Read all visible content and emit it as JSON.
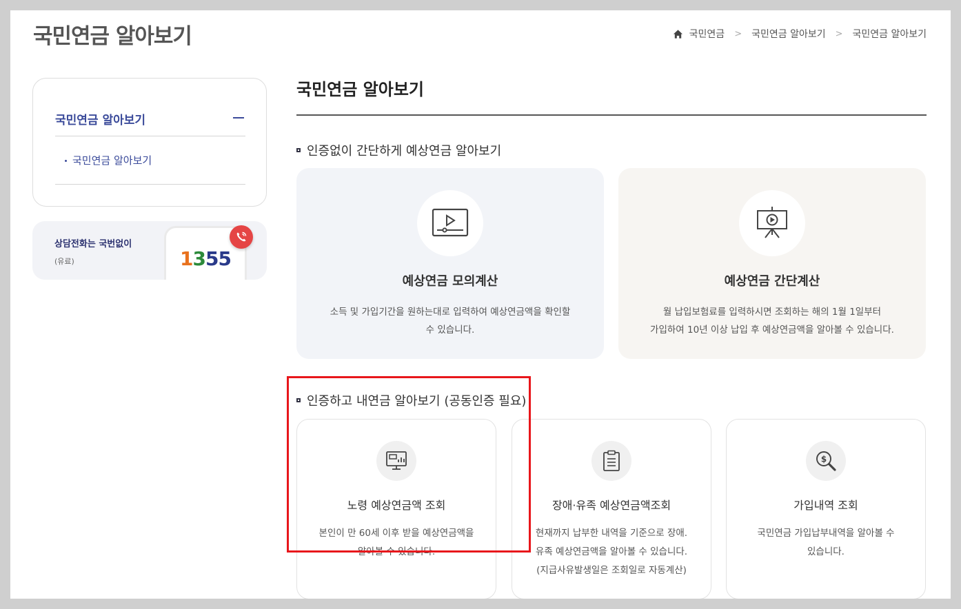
{
  "header": {
    "page_title": "국민연금 알아보기",
    "breadcrumb": [
      "국민연금",
      "국민연금 알아보기",
      "국민연금 알아보기"
    ]
  },
  "sidebar": {
    "menu_title": "국민연금 알아보기",
    "sub_item": "국민연금 알아보기"
  },
  "call_banner": {
    "title": "상담전화는 국번없이",
    "subtitle": "(유료)",
    "number_digits": [
      "1",
      "3",
      "5",
      "5"
    ],
    "digit_colors": [
      "#e8711d",
      "#2c8a3a",
      "#2a3a8a",
      "#2a3a8a"
    ],
    "badge_color": "#e54545"
  },
  "main": {
    "title": "국민연금 알아보기",
    "section1": {
      "title": "인증없이 간단하게 예상연금 알아보기",
      "cards": [
        {
          "icon": "video-monitor-icon",
          "title": "예상연금 모의계산",
          "desc_lines": [
            "소득 및 가입기간을 원하는대로 입력하여 예상연금액을 확인할",
            "수 있습니다."
          ],
          "bg": "#f2f4f8"
        },
        {
          "icon": "presentation-board-icon",
          "title": "예상연금 간단계산",
          "desc_lines": [
            "월 납입보험료를 입력하시면 조회하는 해의 1월 1일부터",
            "가입하여 10년 이상 납입 후 예상연금액을 알아볼 수 있습니다."
          ],
          "bg": "#f7f5f2"
        }
      ]
    },
    "section2": {
      "title": "인증하고 내연금 알아보기 (공동인증 필요)",
      "cards": [
        {
          "icon": "monitor-chart-icon",
          "title": "노령 예상연금액 조회",
          "desc_lines": [
            "본인이 만 60세 이후 받을 예상연금액을",
            "알아볼 수 있습니다."
          ]
        },
        {
          "icon": "clipboard-icon",
          "title": "장애·유족 예상연금액조회",
          "desc_lines": [
            "현재까지 납부한 내역을 기준으로 장애.",
            "유족 예상연금액을 알아볼 수 있습니다.",
            "(지급사유발생일은 조회일로 자동계산)"
          ]
        },
        {
          "icon": "money-search-icon",
          "title": "가입내역 조회",
          "desc_lines": [
            "국민연금 가입납부내역을 알아볼 수",
            "있습니다."
          ]
        }
      ]
    }
  },
  "annotation": {
    "highlight_color": "#e8161b"
  }
}
